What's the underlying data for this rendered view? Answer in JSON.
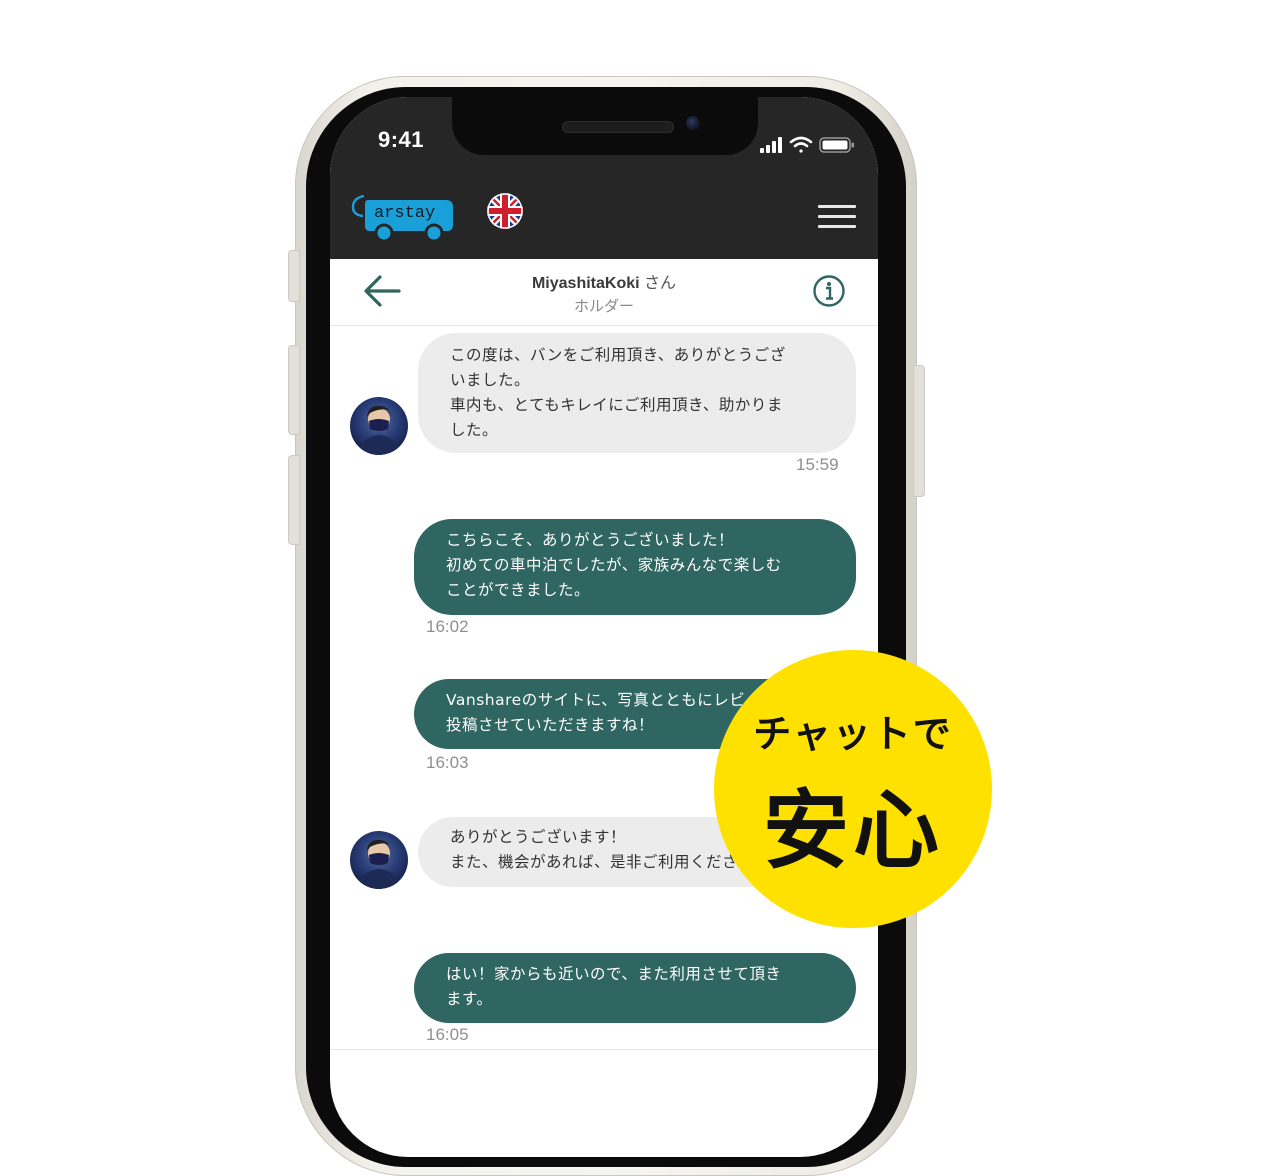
{
  "status_bar": {
    "time": "9:41"
  },
  "app": {
    "logo_text": "arstay",
    "logo_initial": "C"
  },
  "chat_header": {
    "name": "MiyashitaKoki",
    "honorific": "さん",
    "role": "ホルダー"
  },
  "messages": [
    {
      "side": "in",
      "text": "この度は、バンをご利用頂き、ありがとうござ\nいました。\n車内も、とてもキレイにご利用頂き、助かりま\nした。",
      "time": "15:59"
    },
    {
      "side": "out",
      "text": "こちらこそ、ありがとうございました！\n初めての車中泊でしたが、家族みんなで楽しむ\nことができました。",
      "time": "16:02"
    },
    {
      "side": "out",
      "text": "Vanshareのサイトに、写真とともにレビューを\n投稿させていただきますね！",
      "time": "16:03"
    },
    {
      "side": "in",
      "text": "ありがとうございます！\nまた、機会があれば、是非ご利用ください。",
      "time": ""
    },
    {
      "side": "out",
      "text": "はい！家からも近いので、また利用させて頂き\nます。",
      "time": "16:05"
    }
  ],
  "badge": {
    "line1": "チャットで",
    "line2": "安心",
    "color": "#ffe100"
  },
  "colors": {
    "outgoing_bubble": "#2f6661",
    "incoming_bubble": "#ececec",
    "app_bar": "#262626",
    "logo_blue": "#1aa0d8"
  }
}
